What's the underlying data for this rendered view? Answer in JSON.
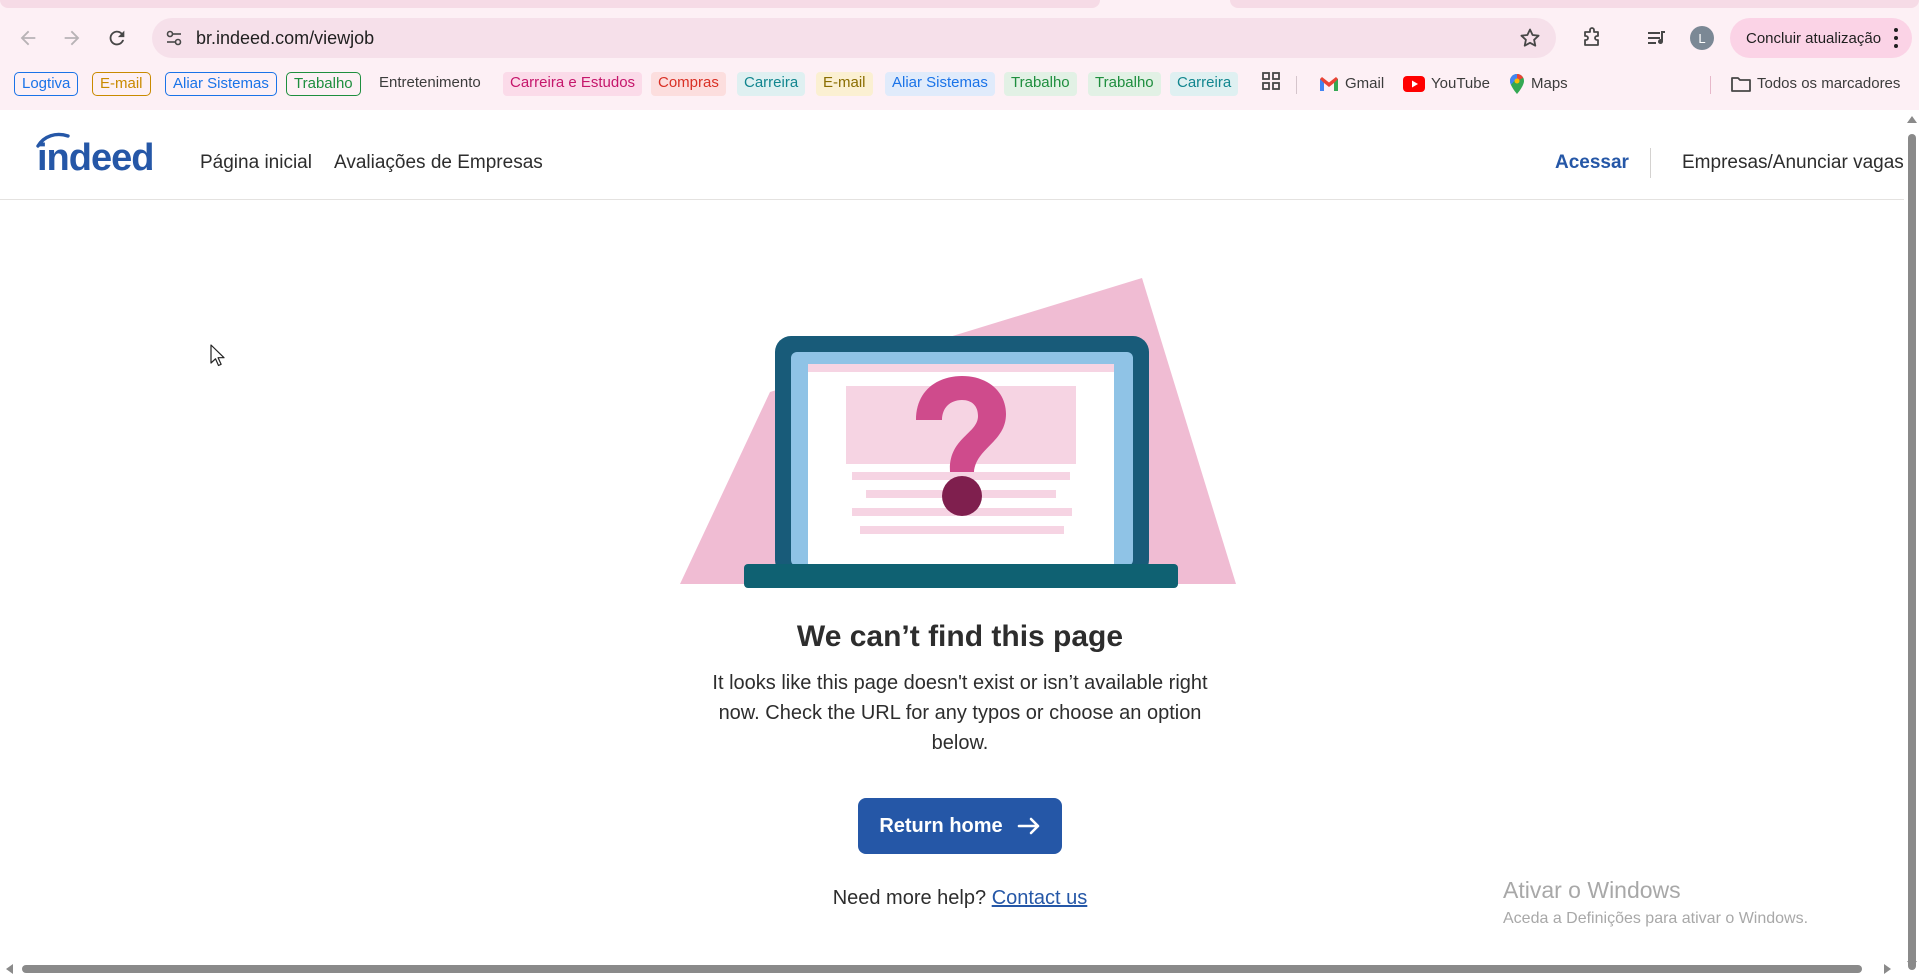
{
  "browser": {
    "url": "br.indeed.com/viewjob",
    "avatar_letter": "L",
    "update_label": "Concluir atualização",
    "icons": [
      "back-icon",
      "forward-icon",
      "reload-icon",
      "site-info-icon",
      "star-icon",
      "extensions-icon",
      "media-icon",
      "menu-dots-icon"
    ]
  },
  "bookmarks": {
    "items": [
      {
        "label": "Logtiva",
        "color": "#1a73e8"
      },
      {
        "label": "E-mail",
        "color": "#c98a00"
      },
      {
        "label": "Aliar Sistemas",
        "color": "#1a73e8"
      },
      {
        "label": "Trabalho",
        "color": "#1e8e3e"
      },
      {
        "label": "Entretenimento",
        "color": "#3c3c3c"
      },
      {
        "label": "Carreira e Estudos",
        "color": "#c5166b"
      },
      {
        "label": "Compras",
        "color": "#d93025"
      },
      {
        "label": "Carreira",
        "color": "#12868f"
      },
      {
        "label": "E-mail",
        "color": "#8a6d00"
      },
      {
        "label": "Aliar Sistemas",
        "color": "#1a73e8"
      },
      {
        "label": "Trabalho",
        "color": "#1e8e3e"
      },
      {
        "label": "Trabalho",
        "color": "#1e8e3e"
      },
      {
        "label": "Carreira",
        "color": "#12868f"
      }
    ],
    "gmail": "Gmail",
    "youtube": "YouTube",
    "maps": "Maps",
    "all_bookmarks": "Todos os marcadores"
  },
  "header": {
    "logo_text": "indeed",
    "home_link": "Página inicial",
    "reviews_link": "Avaliações de Empresas",
    "signin_link": "Acessar",
    "employers_link": "Empresas/Anunciar vagas"
  },
  "main": {
    "title": "We can’t find this page",
    "description": "It looks like this page doesn't exist or isn’t available right now. Check the URL for any typos or choose an option below.",
    "return_button": "Return home",
    "help_prefix": "Need more help?",
    "contact_link": "Contact us"
  },
  "watermark": {
    "title": "Ativar o Windows",
    "subtitle": "Aceda a Definições para ativar o Windows."
  },
  "colors": {
    "brand": "#2557a7",
    "chrome_bg": "#fdf0f5",
    "illustration_pink": "#f0bcd3"
  }
}
